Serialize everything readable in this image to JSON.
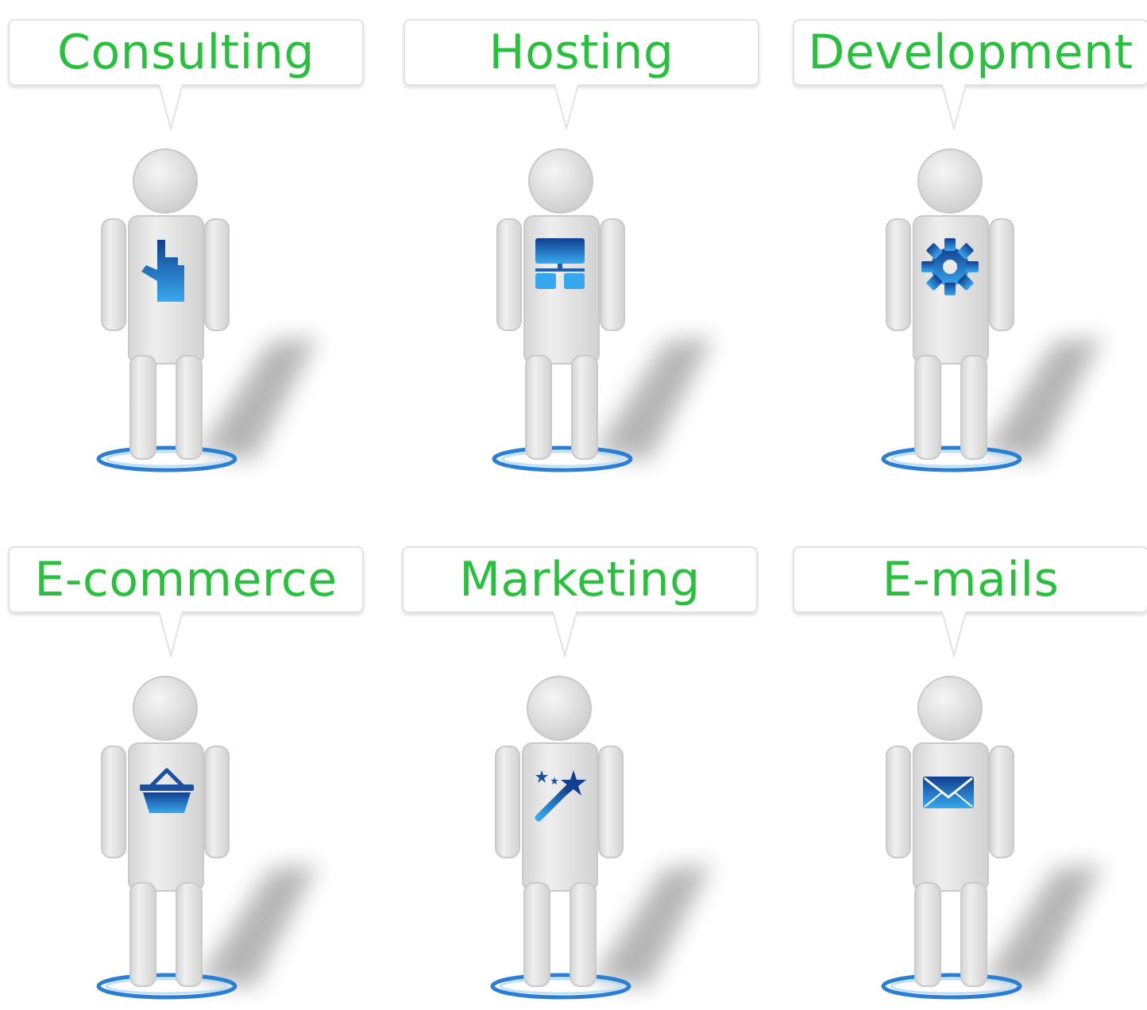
{
  "services": [
    {
      "label": "Consulting",
      "icon": "pointing-hand-icon"
    },
    {
      "label": "Hosting",
      "icon": "network-hosting-icon"
    },
    {
      "label": "Development",
      "icon": "gear-icon"
    },
    {
      "label": "E-commerce",
      "icon": "shopping-basket-icon"
    },
    {
      "label": "Marketing",
      "icon": "magic-wand-icon"
    },
    {
      "label": "E-mails",
      "icon": "envelope-icon"
    }
  ],
  "colors": {
    "label_green": "#2bbf3f",
    "icon_blue_dark": "#123f8f",
    "icon_blue_light": "#38a8ee",
    "ring_blue": "#2a7fd4",
    "figure_gray": "#e6e6e6"
  }
}
